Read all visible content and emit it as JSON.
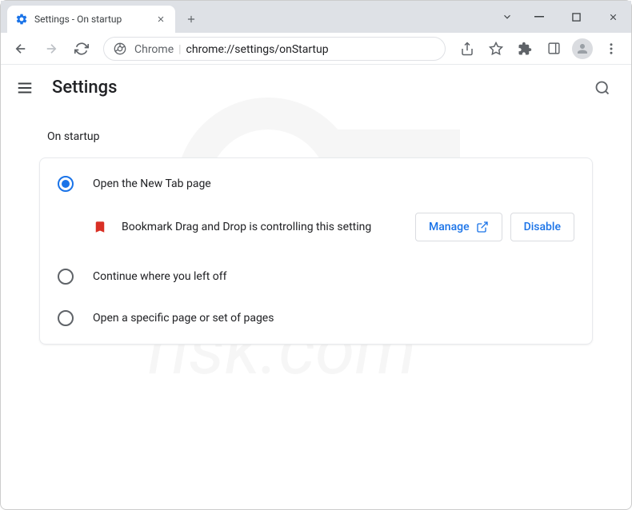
{
  "tab": {
    "title": "Settings - On startup"
  },
  "url": {
    "host": "Chrome",
    "path": "chrome://settings/onStartup"
  },
  "header": {
    "title": "Settings"
  },
  "section": {
    "title": "On startup"
  },
  "options": [
    {
      "label": "Open the New Tab page",
      "selected": true
    },
    {
      "label": "Continue where you left off",
      "selected": false
    },
    {
      "label": "Open a specific page or set of pages",
      "selected": false
    }
  ],
  "notice": {
    "text": "Bookmark Drag and Drop is controlling this setting",
    "manage_label": "Manage",
    "disable_label": "Disable"
  }
}
